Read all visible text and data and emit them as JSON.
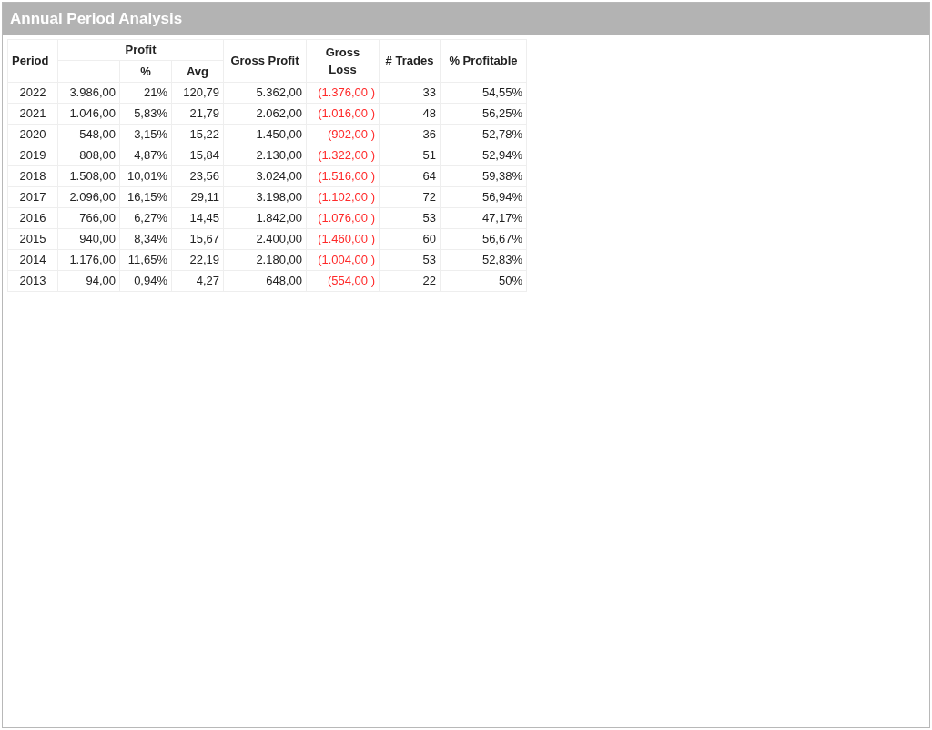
{
  "panel": {
    "title": "Annual Period Analysis"
  },
  "table": {
    "headers": {
      "period": "Period",
      "profit": "Profit",
      "profit_pct": "%",
      "profit_avg": "Avg",
      "gross_profit": "Gross Profit",
      "gross_loss": "Gross Loss",
      "trades": "# Trades",
      "pct_profitable": "% Profitable"
    },
    "rows": [
      [
        "2022",
        "3.986,00",
        "21%",
        "120,79",
        "5.362,00",
        "(1.376,00 )",
        "33",
        "54,55%"
      ],
      [
        "2021",
        "1.046,00",
        "5,83%",
        "21,79",
        "2.062,00",
        "(1.016,00 )",
        "48",
        "56,25%"
      ],
      [
        "2020",
        "548,00",
        "3,15%",
        "15,22",
        "1.450,00",
        "(902,00 )",
        "36",
        "52,78%"
      ],
      [
        "2019",
        "808,00",
        "4,87%",
        "15,84",
        "2.130,00",
        "(1.322,00 )",
        "51",
        "52,94%"
      ],
      [
        "2018",
        "1.508,00",
        "10,01%",
        "23,56",
        "3.024,00",
        "(1.516,00 )",
        "64",
        "59,38%"
      ],
      [
        "2017",
        "2.096,00",
        "16,15%",
        "29,11",
        "3.198,00",
        "(1.102,00 )",
        "72",
        "56,94%"
      ],
      [
        "2016",
        "766,00",
        "6,27%",
        "14,45",
        "1.842,00",
        "(1.076,00 )",
        "53",
        "47,17%"
      ],
      [
        "2015",
        "940,00",
        "8,34%",
        "15,67",
        "2.400,00",
        "(1.460,00 )",
        "60",
        "56,67%"
      ],
      [
        "2014",
        "1.176,00",
        "11,65%",
        "22,19",
        "2.180,00",
        "(1.004,00 )",
        "53",
        "52,83%"
      ],
      [
        "2013",
        "94,00",
        "0,94%",
        "4,27",
        "648,00",
        "(554,00 )",
        "22",
        "50%"
      ]
    ]
  }
}
